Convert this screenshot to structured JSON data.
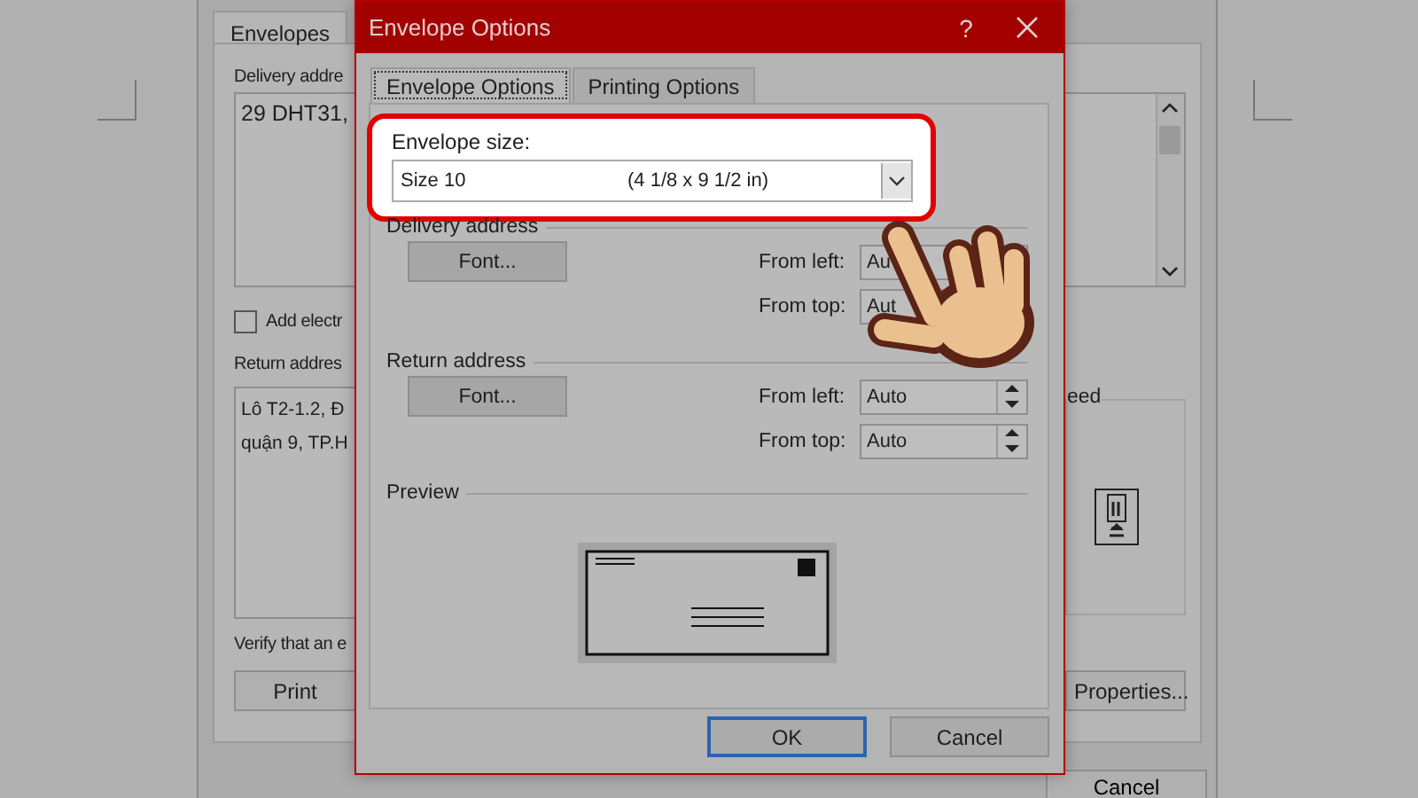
{
  "envelopes_dialog": {
    "tabs": [
      {
        "label": "Envelopes",
        "selected": true
      }
    ],
    "delivery_label": "Delivery addre",
    "delivery_address": "29 DHT31,",
    "electronic_postage": {
      "label": "Add electr",
      "checked": false
    },
    "return_label": "Return addres",
    "return_address_lines": [
      "Lô T2-1.2, Đ",
      "quận 9, TP.H"
    ],
    "feed_label": "eed",
    "verify_text": "Verify that an e",
    "print_button": "Print",
    "properties_button": "Properties...",
    "cancel_button": "Cancel"
  },
  "dialog": {
    "title": "Envelope Options",
    "help": "?",
    "tabs": [
      {
        "label": "Envelope Options",
        "selected": true
      },
      {
        "label": "Printing Options",
        "selected": false
      }
    ],
    "envelope_size": {
      "label": "Envelope size:",
      "value": "Size 10",
      "dimensions": "(4 1/8 x 9 1/2 in)",
      "highlighted": true
    },
    "sections": [
      {
        "title": "Delivery address",
        "font_button": "Font...",
        "from_left": {
          "label": "From left:",
          "value": "Au"
        },
        "from_top": {
          "label": "From top:",
          "value": "Aut"
        }
      },
      {
        "title": "Return address",
        "font_button": "Font...",
        "from_left": {
          "label": "From left:",
          "value": "Auto"
        },
        "from_top": {
          "label": "From top:",
          "value": "Auto"
        }
      }
    ],
    "preview": {
      "title": "Preview"
    },
    "buttons": [
      {
        "label": "OK",
        "default": true
      },
      {
        "label": "Cancel",
        "default": false
      }
    ]
  }
}
